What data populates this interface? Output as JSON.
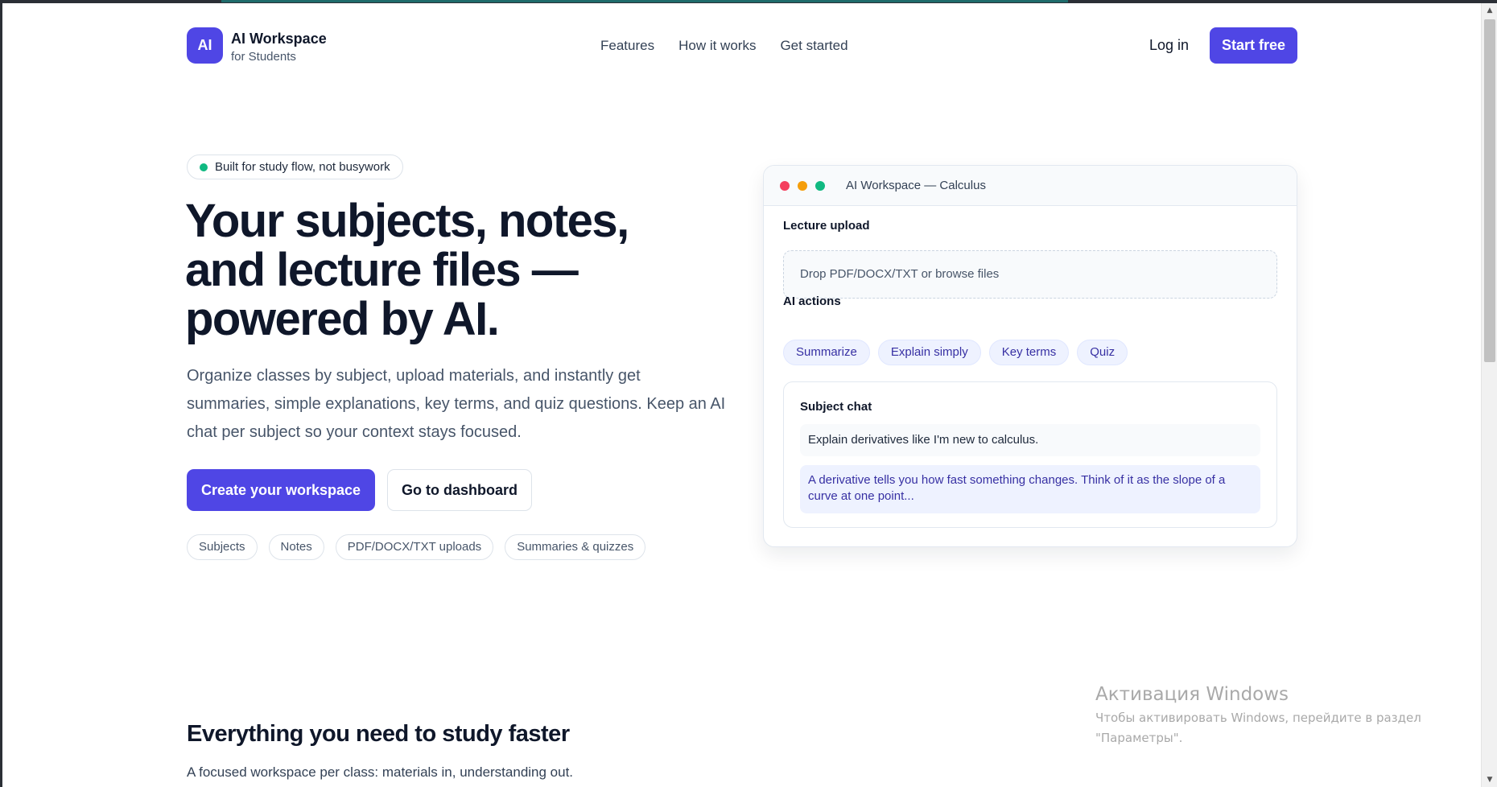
{
  "header": {
    "logo_text": "AI",
    "brand_title": "AI Workspace",
    "brand_subtitle": "for Students",
    "nav": [
      "Features",
      "How it works",
      "Get started"
    ],
    "login_label": "Log in",
    "start_label": "Start free"
  },
  "hero": {
    "badge": "Built for study flow, not busywork",
    "title_lines": [
      "Your subjects, notes,",
      "and lecture files —",
      "powered by AI."
    ],
    "description": "Organize classes by subject, upload materials, and instantly get summaries, simple explanations, key terms, and quiz questions. Keep an AI chat per subject so your context stays focused.",
    "primary_cta": "Create your workspace",
    "secondary_cta": "Go to dashboard",
    "tags": [
      "Subjects",
      "Notes",
      "PDF/DOCX/TXT uploads",
      "Summaries & quizzes"
    ]
  },
  "preview": {
    "window_title": "AI Workspace — Calculus",
    "upload_label": "Lecture upload",
    "upload_placeholder": "Drop PDF/DOCX/TXT or browse files",
    "actions_label": "AI actions",
    "actions": [
      "Summarize",
      "Explain simply",
      "Key terms",
      "Quiz"
    ],
    "chat_label": "Subject chat",
    "user_message": "Explain derivatives like I'm new to calculus.",
    "ai_message": "A derivative tells you how fast something changes. Think of it as the slope of a curve at one point..."
  },
  "features": {
    "title": "Everything you need to study faster",
    "subtitle": "A focused workspace per class: materials in, understanding out."
  },
  "watermark": {
    "title": "Активация Windows",
    "line1": "Чтобы активировать Windows, перейдите в раздел",
    "line2": "\"Параметры\"."
  },
  "colors": {
    "accent": "#4f46e5",
    "status_dot": "#10b981",
    "traffic_red": "#f43f5e",
    "traffic_yellow": "#f59e0b",
    "traffic_green": "#10b981"
  }
}
